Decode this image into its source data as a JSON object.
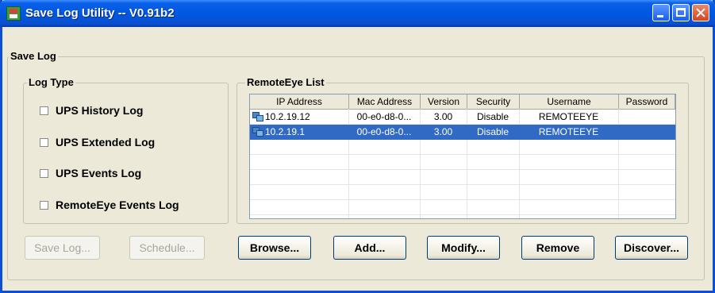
{
  "window": {
    "title": "Save Log Utility -- V0.91b2"
  },
  "main_group": {
    "label": "Save Log"
  },
  "log_type": {
    "label": "Log Type",
    "items": [
      {
        "label": "UPS History Log",
        "checked": false
      },
      {
        "label": "UPS Extended Log",
        "checked": false
      },
      {
        "label": "UPS Events Log",
        "checked": false
      },
      {
        "label": "RemoteEye Events Log",
        "checked": false
      }
    ]
  },
  "remote_list": {
    "label": "RemoteEye List",
    "columns": [
      "IP Address",
      "Mac Address",
      "Version",
      "Security",
      "Username",
      "Password"
    ],
    "rows": [
      {
        "ip": "10.2.19.12",
        "mac": "00-e0-d8-0...",
        "version": "3.00",
        "security": "Disable",
        "username": "REMOTEEYE",
        "password": "",
        "selected": false
      },
      {
        "ip": "10.2.19.1",
        "mac": "00-e0-d8-0...",
        "version": "3.00",
        "security": "Disable",
        "username": "REMOTEEYE",
        "password": "",
        "selected": true
      }
    ]
  },
  "buttons": {
    "save_log": "Save Log...",
    "schedule": "Schedule...",
    "browse": "Browse...",
    "add": "Add...",
    "modify": "Modify...",
    "remove": "Remove",
    "discover": "Discover..."
  },
  "colors": {
    "title_bar": "#0058e0",
    "selection": "#316ac5",
    "dialog_bg": "#ece9d8"
  }
}
